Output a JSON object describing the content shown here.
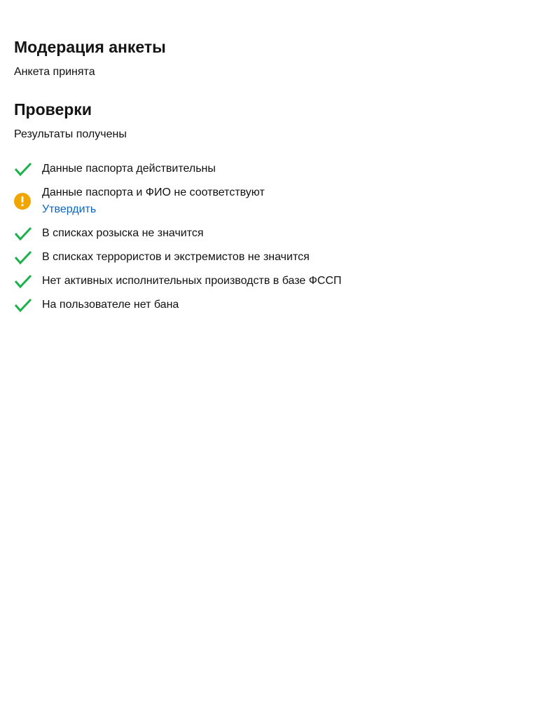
{
  "moderation": {
    "title": "Модерация анкеты",
    "status": "Анкета принята"
  },
  "checks": {
    "title": "Проверки",
    "status": "Результаты получены",
    "items": [
      {
        "status": "ok",
        "icon": "check-icon",
        "text": "Данные паспорта действительны"
      },
      {
        "status": "warning",
        "icon": "warning-icon",
        "text": "Данные паспорта и ФИО не соответствуют",
        "action": "Утвердить"
      },
      {
        "status": "ok",
        "icon": "check-icon",
        "text": "В списках розыска не значится"
      },
      {
        "status": "ok",
        "icon": "check-icon",
        "text": "В списках террористов и экстремистов не значится"
      },
      {
        "status": "ok",
        "icon": "check-icon",
        "text": "Нет активных исполнительных производств в базе ФССП"
      },
      {
        "status": "ok",
        "icon": "check-icon",
        "text": "На пользователе нет бана"
      }
    ]
  },
  "colors": {
    "ok": "#1cb14b",
    "warning": "#f0a500",
    "link": "#0b66c3",
    "text": "#111111"
  }
}
